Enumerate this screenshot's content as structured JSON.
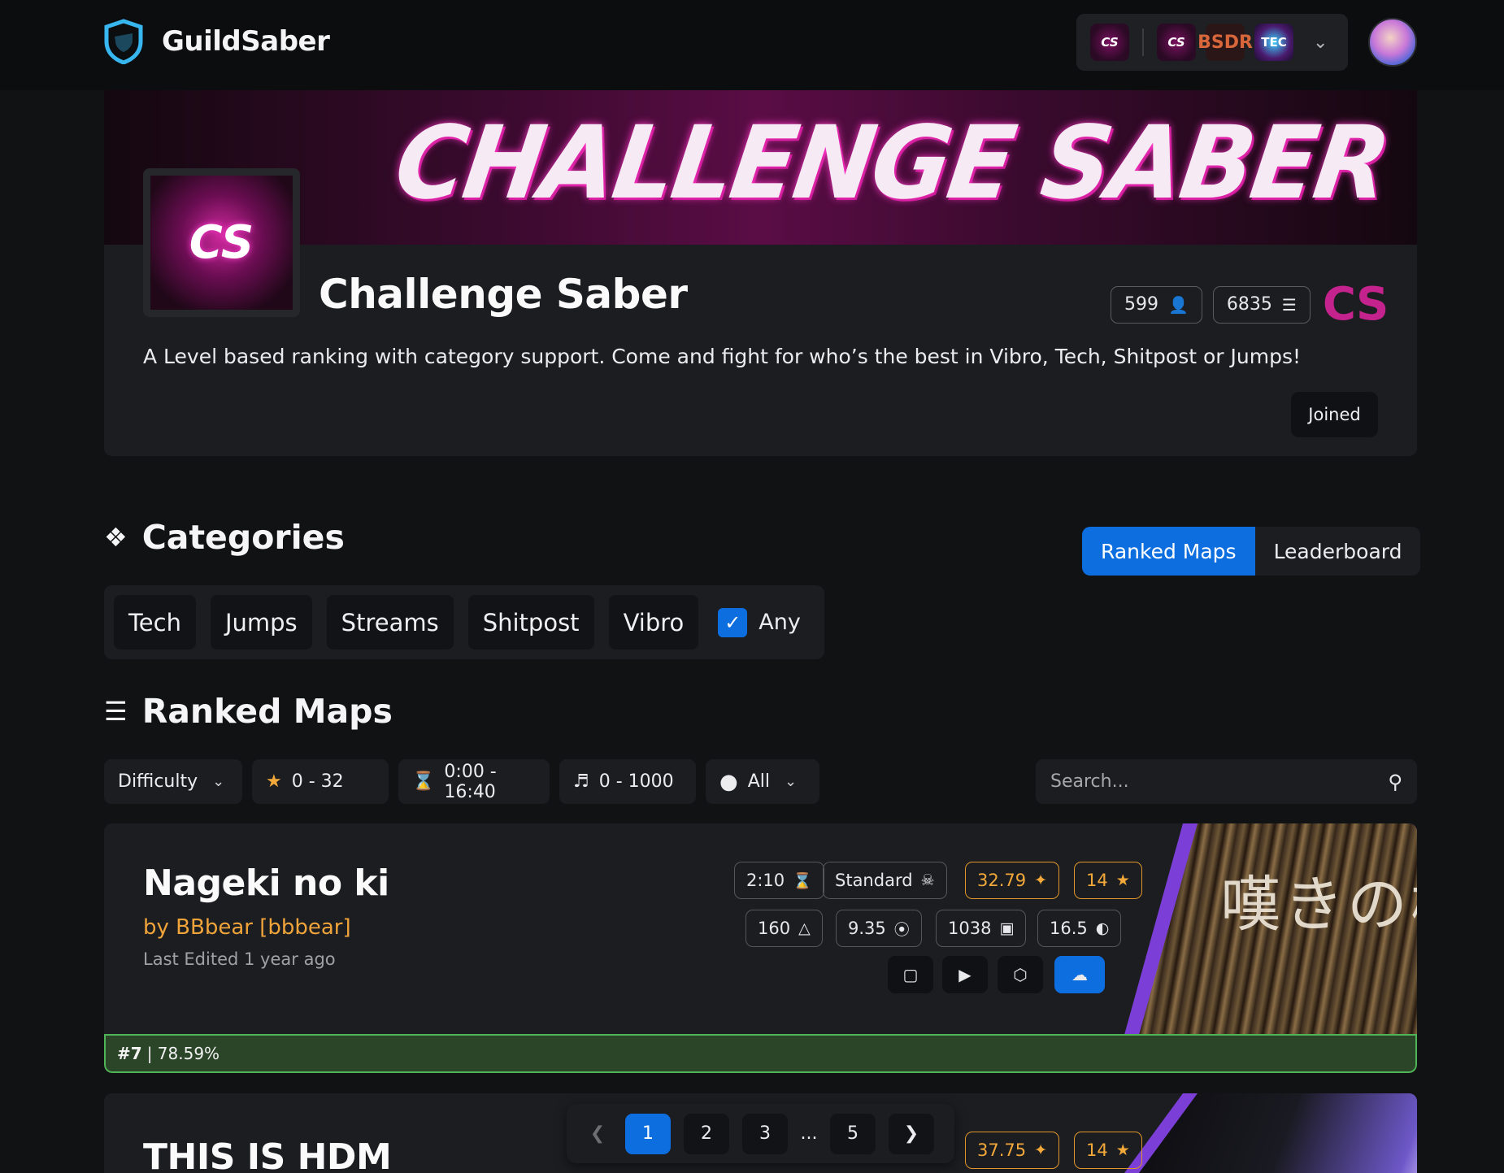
{
  "header": {
    "brand": "GuildSaber",
    "guild_icons": [
      "CS",
      "CS",
      "BSDR",
      "TEC"
    ]
  },
  "guild": {
    "banner_text": "CHALLENGE SABER",
    "logo_text": "CS",
    "name": "Challenge Saber",
    "members": "599",
    "maps": "6835",
    "tag": "CS",
    "description": "A Level based ranking with category support. Come and fight for who’s the best in Vibro, Tech, Shitpost or Jumps!",
    "joined_label": "Joined"
  },
  "categories": {
    "title": "Categories",
    "items": [
      "Tech",
      "Jumps",
      "Streams",
      "Shitpost",
      "Vibro"
    ],
    "any_label": "Any",
    "any_checked": true
  },
  "tabs": {
    "ranked_maps": "Ranked Maps",
    "leaderboard": "Leaderboard",
    "active": "Ranked Maps"
  },
  "ranked_maps": {
    "title": "Ranked Maps",
    "filters": {
      "difficulty": "Difficulty",
      "stars": "0 - 32",
      "duration": "0:00 - 16:40",
      "bpm": "0 - 1000",
      "status": "All"
    },
    "search_placeholder": "Search..."
  },
  "maps": [
    {
      "title": "Nageki no ki",
      "mapper": "by BBbear [bbbear]",
      "edited": "Last Edited 1 year ago",
      "duration": "2:10",
      "difficulty": "Standard",
      "stars_value": "32.79",
      "level": "14",
      "bpm": "160",
      "njs": "9.35",
      "notes": "1038",
      "nps": "16.5",
      "art_text": "嘆きの樹",
      "rank": "#7",
      "accuracy": "| 78.59%"
    },
    {
      "title": "THIS IS HDM",
      "stars_value": "37.75",
      "level": "14"
    }
  ],
  "pagination": {
    "pages": [
      "1",
      "2",
      "3",
      "...",
      "5"
    ],
    "current": "1"
  },
  "colors": {
    "accent": "#0d6ee0",
    "gold": "#f3a93a",
    "guild_tag": "#c4228c",
    "rank_bar": "#2a4528",
    "art_stripe": "#7b3fd8"
  }
}
